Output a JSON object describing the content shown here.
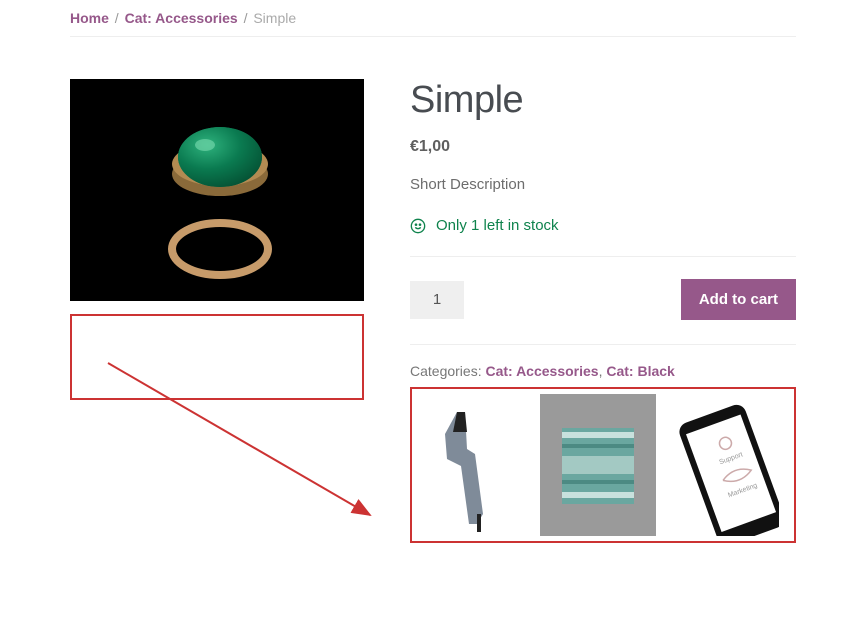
{
  "breadcrumb": {
    "home": "Home",
    "cat": "Cat: Accessories",
    "current": "Simple",
    "sep": "/"
  },
  "product": {
    "title": "Simple",
    "price": "€1,00",
    "short_desc": "Short Description",
    "stock": "Only 1 left in stock",
    "qty": "1",
    "add_to_cart": "Add to cart",
    "categories_label": "Categories:",
    "cat1": "Cat: Accessories",
    "cat2": "Cat: Black",
    "comma": ","
  }
}
